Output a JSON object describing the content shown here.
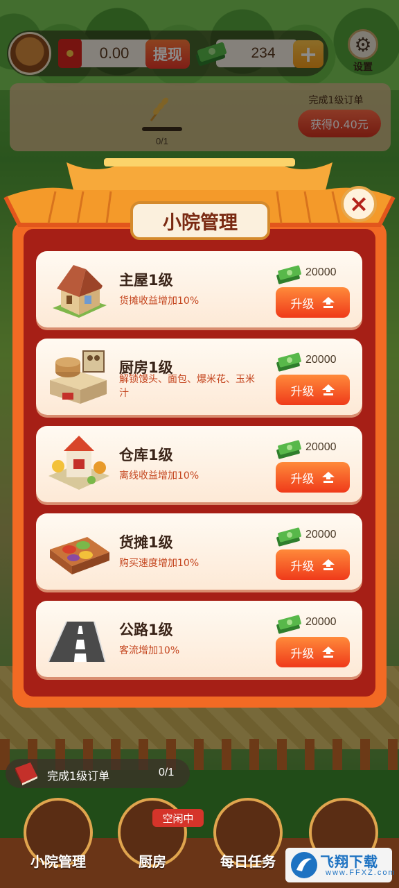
{
  "header": {
    "red_packet_balance": "0.00",
    "withdraw_label": "提现",
    "cash_count": "234",
    "add_label": "+",
    "settings_label": "设置"
  },
  "order_banner": {
    "progress_text": "0/1",
    "progress_fraction": 0,
    "title": "完成1级订单",
    "reward_label": "获得0.40元"
  },
  "modal": {
    "title": "小院管理",
    "close_label": "×",
    "items": [
      {
        "name": "主屋1级",
        "desc": "货摊收益增加10%",
        "cost": "20000",
        "button": "升级"
      },
      {
        "name": "厨房1级",
        "desc": "解锁馒头、面包、爆米花、玉米汁",
        "cost": "20000",
        "button": "升级"
      },
      {
        "name": "仓库1级",
        "desc": "离线收益增加10%",
        "cost": "20000",
        "button": "升级"
      },
      {
        "name": "货摊1级",
        "desc": "购买速度增加10%",
        "cost": "20000",
        "button": "升级"
      },
      {
        "name": "公路1级",
        "desc": "客流增加10%",
        "cost": "20000",
        "button": "升级"
      }
    ]
  },
  "task": {
    "text": "完成1级订单",
    "progress": "0/1"
  },
  "nav": {
    "items": [
      {
        "label": "小院管理"
      },
      {
        "label": "厨房",
        "tag": "空闲中"
      },
      {
        "label": "每日任务"
      },
      {
        "label": ""
      }
    ]
  },
  "watermark": {
    "title": "飞翔下载",
    "url": "www.FFXZ.com"
  },
  "colors": {
    "modal_orange": "#f26a24",
    "modal_red": "#a61f16",
    "button_red": "#ef3a1a",
    "desc_red": "#c4451e",
    "cash_green": "#3e9a3a"
  }
}
